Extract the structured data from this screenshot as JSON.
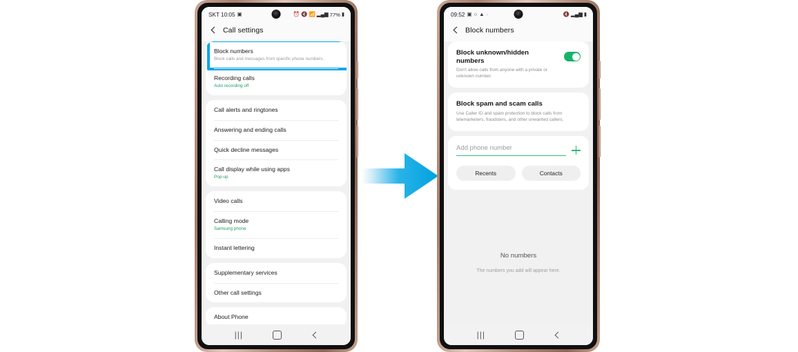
{
  "meta": {
    "accent_cyan": "#05a6e8",
    "accent_green": "#1f9c5d",
    "toggle_green": "#17b26a"
  },
  "arrow": {
    "name": "right-arrow",
    "color_start": "#b9e6f7",
    "color_end": "#00a6e2"
  },
  "left_phone": {
    "status_bar": {
      "carrier_time": "SKT 10:05",
      "left_icons": [
        "picture-icon"
      ],
      "right_icons": [
        "alarm-icon",
        "mute-icon",
        "wifi-icon",
        "signal-icon"
      ],
      "battery_percent": "77%",
      "battery_icon": "battery-icon"
    },
    "app_bar": {
      "back": "back-icon",
      "title": "Call settings"
    },
    "groups": [
      {
        "name": "group-primary",
        "rows": [
          {
            "title": "Block numbers",
            "sub": "Block calls and messages from specific phone numbers.",
            "sub_style": "grey",
            "highlighted": true
          },
          {
            "title": "Recording calls",
            "sub": "Auto recording off",
            "sub_style": "green",
            "highlighted": false
          }
        ]
      },
      {
        "name": "group-alerts",
        "rows": [
          {
            "title": "Call alerts and ringtones",
            "sub": "",
            "sub_style": "",
            "highlighted": false
          },
          {
            "title": "Answering and ending calls",
            "sub": "",
            "sub_style": "",
            "highlighted": false
          },
          {
            "title": "Quick decline messages",
            "sub": "",
            "sub_style": "",
            "highlighted": false
          },
          {
            "title": "Call display while using apps",
            "sub": "Pop-up",
            "sub_style": "green",
            "highlighted": false
          }
        ]
      },
      {
        "name": "group-calling",
        "rows": [
          {
            "title": "Video calls",
            "sub": "",
            "sub_style": "",
            "highlighted": false
          },
          {
            "title": "Calling mode",
            "sub": "Samsung phone",
            "sub_style": "green",
            "highlighted": false
          },
          {
            "title": "Instant lettering",
            "sub": "",
            "sub_style": "",
            "highlighted": false
          }
        ]
      },
      {
        "name": "group-services",
        "rows": [
          {
            "title": "Supplementary services",
            "sub": "",
            "sub_style": "",
            "highlighted": false
          },
          {
            "title": "Other call settings",
            "sub": "",
            "sub_style": "",
            "highlighted": false
          }
        ]
      },
      {
        "name": "group-about",
        "rows": [
          {
            "title": "About Phone",
            "sub": "",
            "sub_style": "",
            "highlighted": false
          }
        ]
      }
    ],
    "nav_bar": {
      "recents": "|||",
      "home": "home-icon",
      "back": "back-icon"
    }
  },
  "right_phone": {
    "status_bar": {
      "carrier_time": "09:52",
      "left_icons": [
        "picture-icon",
        "circle-icon",
        "warning-icon",
        "dot-icon"
      ],
      "right_icons": [
        "mute-icon",
        "signal-icon",
        "battery-icon"
      ],
      "battery_percent": ""
    },
    "app_bar": {
      "back": "back-icon",
      "title": "Block numbers"
    },
    "block_unknown": {
      "title": "Block unknown/hidden numbers",
      "sub": "Don't allow calls from anyone with a private or unknown number.",
      "toggle_on": true
    },
    "block_spam": {
      "title": "Block spam and scam calls",
      "sub": "Use Caller ID and spam protection to block calls from telemarketers, fraudsters, and other unwanted callers."
    },
    "add_number": {
      "placeholder": "Add phone number",
      "value": "",
      "add_icon": "plus-icon"
    },
    "pills": [
      {
        "label": "Recents"
      },
      {
        "label": "Contacts"
      }
    ],
    "empty_state": {
      "title": "No numbers",
      "sub": "The numbers you add will appear here."
    },
    "nav_bar": {
      "recents": "|||",
      "home": "home-icon",
      "back": "back-icon"
    }
  }
}
